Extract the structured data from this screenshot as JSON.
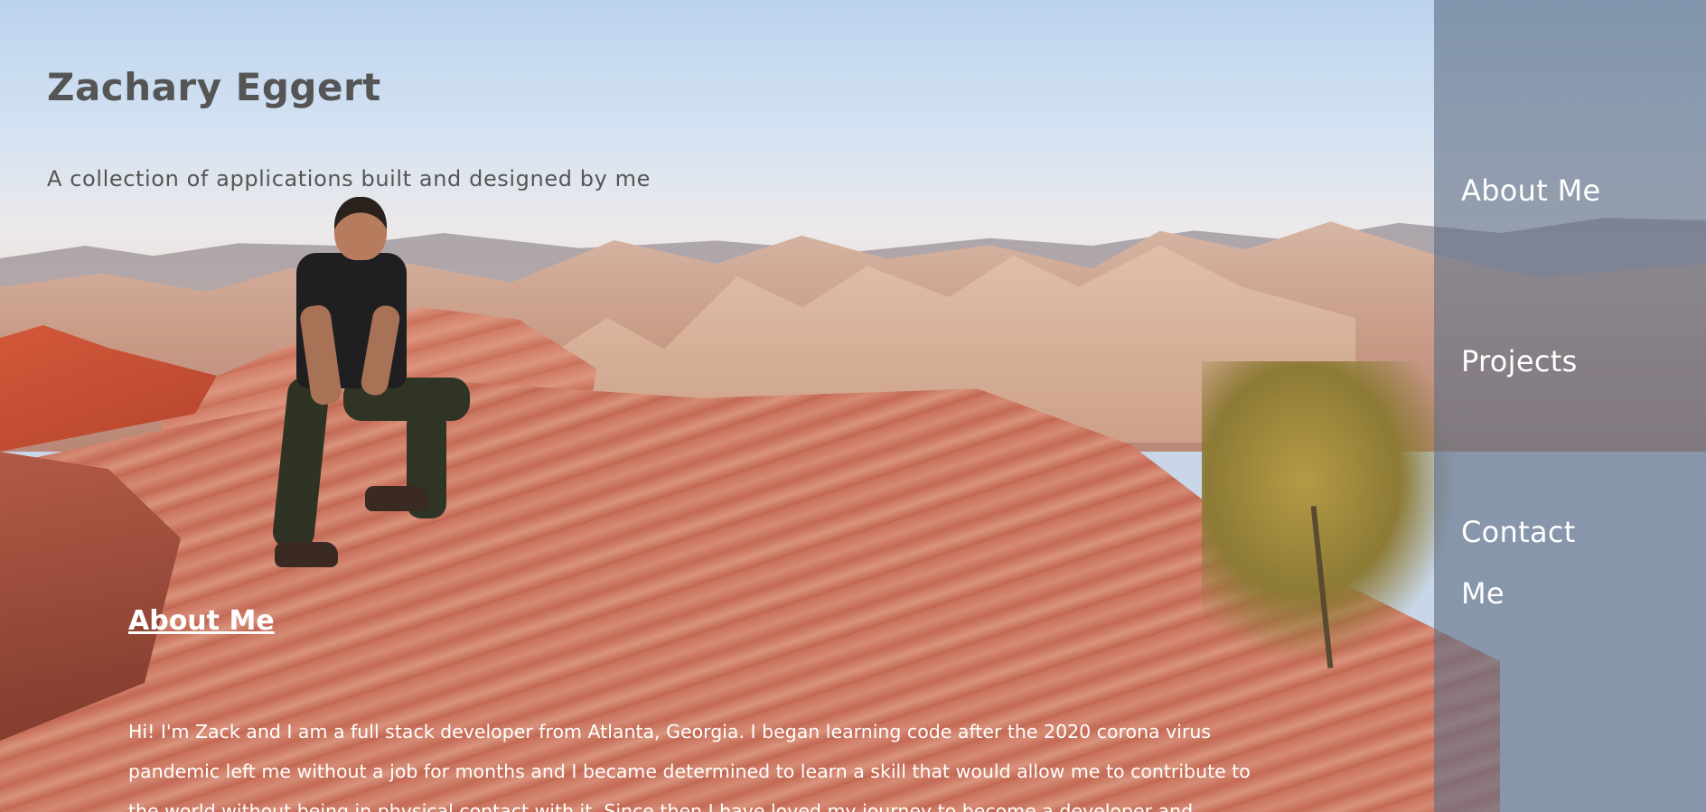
{
  "header": {
    "title": "Zachary Eggert",
    "tagline": "A collection of applications built and designed by me"
  },
  "nav": {
    "items": [
      {
        "label": "About Me"
      },
      {
        "label": "Projects"
      },
      {
        "label": "Contact Me"
      }
    ]
  },
  "about": {
    "heading": "About Me",
    "text": "Hi! I'm Zack and I am a full stack developer from Atlanta, Georgia. I began learning code after the 2020 corona virus pandemic left me without a job for months and I became determined to learn a skill that would allow me to contribute to the world without being in physical contact with it. Since then I have loved my journey to become a developer and"
  },
  "colors": {
    "title_text": "#555555",
    "nav_panel": "#607086",
    "body_text_on_image": "#ffffff"
  }
}
